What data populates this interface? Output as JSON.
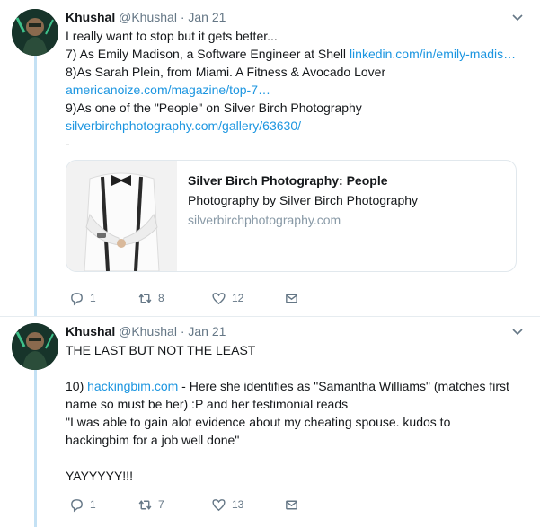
{
  "tweets": [
    {
      "name": "Khushal",
      "handle": "@Khushal",
      "date": "Jan 21",
      "lines": [
        {
          "text": "I really want to stop but it gets better...",
          "link": ""
        },
        {
          "text": "7) As Emily Madison, a Software Engineer at Shell ",
          "link": "linkedin.com/in/emily-madis…"
        },
        {
          "text": "8)As Sarah Plein, from Miami. A Fitness & Avocado Lover",
          "link": ""
        },
        {
          "text": "",
          "link": "americanoize.com/magazine/top-7…"
        },
        {
          "text": "9)As one of the \"People\" on Silver Birch Photography",
          "link": ""
        },
        {
          "text": "",
          "link": "silverbirchphotography.com/gallery/63630/"
        },
        {
          "text": "-",
          "link": ""
        }
      ],
      "card": {
        "title": "Silver Birch Photography: People",
        "description": "Photography by Silver Birch Photography",
        "domain": "silverbirchphotography.com"
      },
      "actions": {
        "replies": "1",
        "retweets": "8",
        "likes": "12"
      }
    },
    {
      "name": "Khushal",
      "handle": "@Khushal",
      "date": "Jan 21",
      "para1": "THE LAST BUT NOT THE LEAST",
      "para2_prefix": "10) ",
      "para2_link": "hackingbim.com",
      "para2_rest": " - Here she identifies as \"Samantha Williams\"  (matches first name so must be her) :P and her testimonial reads",
      "quote": "\"I was able to gain alot evidence about my cheating spouse. kudos to hackingbim for a job well done\"",
      "closing": "YAYYYYY!!!",
      "actions": {
        "replies": "1",
        "retweets": "7",
        "likes": "13"
      }
    }
  ],
  "colors": {
    "link": "#1b95e0",
    "thread": "#c4e1f4",
    "muted": "#657786"
  }
}
